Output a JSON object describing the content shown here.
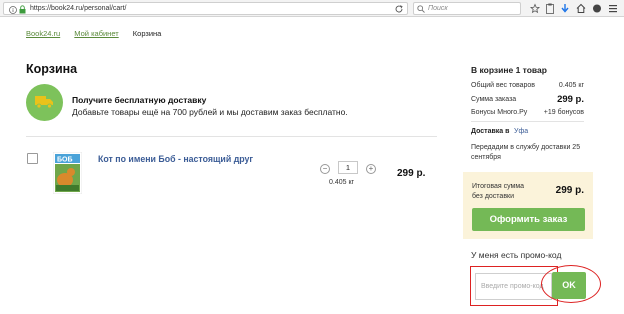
{
  "browser": {
    "url": "https://book24.ru/personal/cart/",
    "search_placeholder": "Поиск"
  },
  "breadcrumb": {
    "items": [
      "Book24.ru",
      "Мой кабинет"
    ],
    "current": "Корзина"
  },
  "page_title": "Корзина",
  "delivery_promo": {
    "title": "Получите бесплатную доставку",
    "text": "Добавьте товары ещё на 700 рублей и мы доставим заказ бесплатно."
  },
  "cart_item": {
    "title": "Кот по имени Боб - настоящий друг",
    "quantity": "1",
    "weight": "0.405 кг",
    "price": "299 р.",
    "minus": "−",
    "plus": "+"
  },
  "summary": {
    "title": "В корзине 1 товар",
    "rows": [
      {
        "label": "Общий вес товаров",
        "value": "0.405 кг"
      },
      {
        "label": "Сумма заказа",
        "value": "299 р."
      },
      {
        "label": "Бонусы Много.Ру",
        "value": "+19 бонусов"
      }
    ],
    "delivery_label": "Доставка в",
    "delivery_city": "Уфа",
    "delivery_note": "Передадим в службу доставки 25 сентября",
    "total_label": "Итоговая сумма без доставки",
    "total_value": "299 р.",
    "checkout_label": "Оформить заказ",
    "promo_label": "У меня есть промо-код",
    "promo_placeholder": "Введите промо-код",
    "ok_label": "OK"
  },
  "colors": {
    "accent_green": "#74b956",
    "link_blue": "#3b5c96",
    "highlight_red": "#d22222",
    "total_bg": "#fbf3da"
  }
}
